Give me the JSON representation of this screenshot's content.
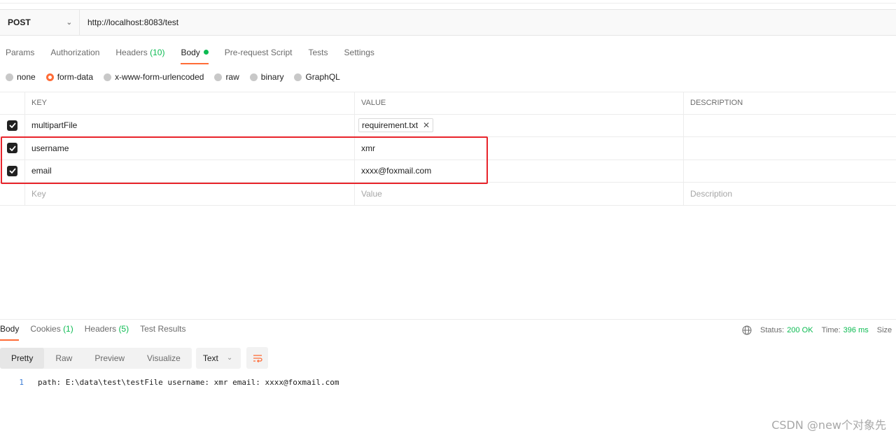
{
  "request": {
    "method": "POST",
    "url": "http://localhost:8083/test"
  },
  "request_tabs": [
    {
      "label": "Params"
    },
    {
      "label": "Authorization"
    },
    {
      "label": "Headers",
      "count": "(10)"
    },
    {
      "label": "Body"
    },
    {
      "label": "Pre-request Script"
    },
    {
      "label": "Tests"
    },
    {
      "label": "Settings"
    }
  ],
  "body_types": [
    "none",
    "form-data",
    "x-www-form-urlencoded",
    "raw",
    "binary",
    "GraphQL"
  ],
  "params_table": {
    "headers": [
      "KEY",
      "VALUE",
      "DESCRIPTION"
    ],
    "rows": [
      {
        "key": "multipartFile",
        "value": "requirement.txt",
        "description": ""
      },
      {
        "key": "username",
        "value": "xmr",
        "description": ""
      },
      {
        "key": "email",
        "value": "xxxx@foxmail.com",
        "description": ""
      }
    ],
    "placeholders": {
      "key": "Key",
      "value": "Value",
      "description": "Description"
    }
  },
  "response_tabs": [
    {
      "label": "Body"
    },
    {
      "label": "Cookies",
      "count": "(1)"
    },
    {
      "label": "Headers",
      "count": "(5)"
    },
    {
      "label": "Test Results"
    }
  ],
  "status": {
    "status_label": "Status:",
    "status_value": "200 OK",
    "time_label": "Time:",
    "time_value": "396 ms",
    "size_label": "Size"
  },
  "view_modes": [
    "Pretty",
    "Raw",
    "Preview",
    "Visualize"
  ],
  "format": "Text",
  "response_body": {
    "line_number": "1",
    "text": "path: E:\\data\\test\\testFile username: xmr email: xxxx@foxmail.com"
  },
  "watermark": "CSDN @new个对象先",
  "colors": {
    "accent": "#ff6c37",
    "success": "#0cbb52",
    "highlight": "#e8242b"
  }
}
